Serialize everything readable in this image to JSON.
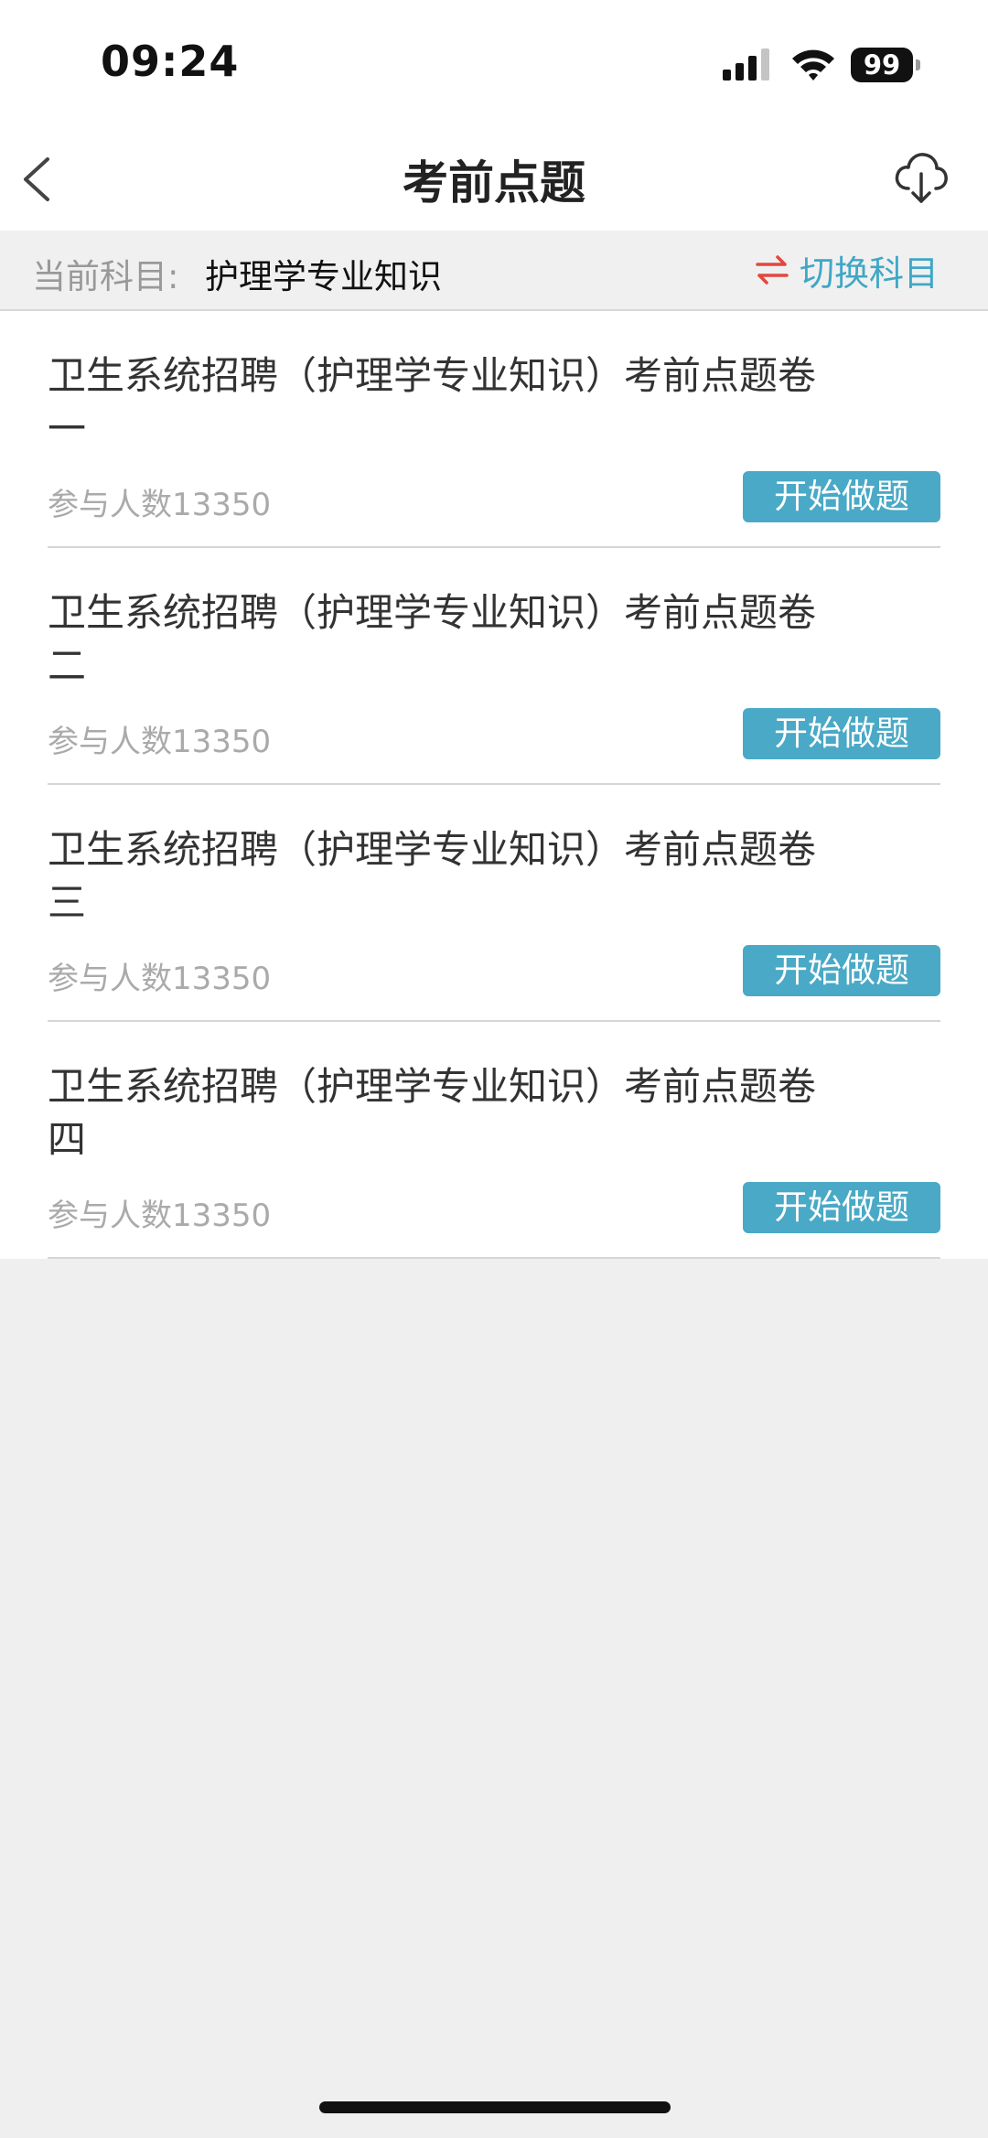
{
  "status_bar": {
    "time": "09:24",
    "battery": "99",
    "signal_icon": "cellular-signal-icon",
    "wifi_icon": "wifi-icon"
  },
  "nav": {
    "title": "考前点题",
    "back_icon": "chevron-left-icon",
    "download_icon": "cloud-download-icon"
  },
  "subject": {
    "label": "当前科目:",
    "value": "护理学专业知识",
    "switch_label": "切换科目",
    "switch_icon": "swap-arrows-icon",
    "switch_icon_color": "#e0483f",
    "accent_color": "#3fa7c6"
  },
  "papers": [
    {
      "title": "卫生系统招聘（护理学专业知识）考前点题卷一",
      "count": "参与人数13350",
      "button": "开始做题"
    },
    {
      "title": "卫生系统招聘（护理学专业知识）考前点题卷二",
      "count": "参与人数13350",
      "button": "开始做题"
    },
    {
      "title": "卫生系统招聘（护理学专业知识）考前点题卷三",
      "count": "参与人数13350",
      "button": "开始做题"
    },
    {
      "title": "卫生系统招聘（护理学专业知识）考前点题卷四",
      "count": "参与人数13350",
      "button": "开始做题"
    }
  ]
}
